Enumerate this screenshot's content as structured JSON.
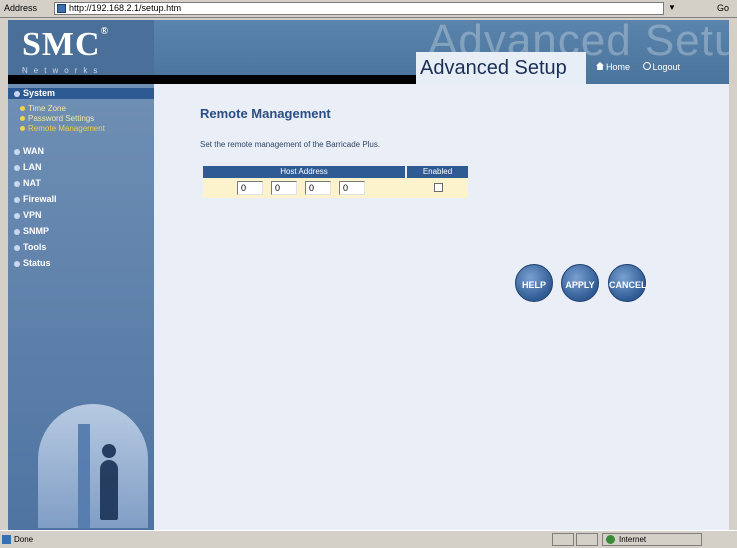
{
  "browser": {
    "address_label": "Address",
    "url": "http://192.168.2.1/setup.htm",
    "go": "Go",
    "status_text": "Done",
    "zone": "Internet"
  },
  "header": {
    "logo": "SMC",
    "logo_reg": "®",
    "logo_sub": "Networks",
    "ghost_title": "Advanced Setup",
    "title": "Advanced Setup",
    "home_link": "Home",
    "logout_link": "Logout"
  },
  "sidebar": {
    "system": "System",
    "system_items": [
      "Time Zone",
      "Password Settings",
      "Remote Management"
    ],
    "items": [
      "WAN",
      "LAN",
      "NAT",
      "Firewall",
      "VPN",
      "SNMP",
      "Tools",
      "Status"
    ]
  },
  "main": {
    "title": "Remote Management",
    "description": "Set the remote management of the Barricade Plus.",
    "table": {
      "col_host": "Host Address",
      "col_enabled": "Enabled",
      "ip": [
        "0",
        "0",
        "0",
        "0"
      ],
      "enabled": false
    },
    "buttons": {
      "help": "HELP",
      "apply": "APPLY",
      "cancel": "CANCEL"
    }
  },
  "colors": {
    "accent": "#2f5b94",
    "sidebar": "#5f82ad",
    "row": "#fcf3cc"
  }
}
